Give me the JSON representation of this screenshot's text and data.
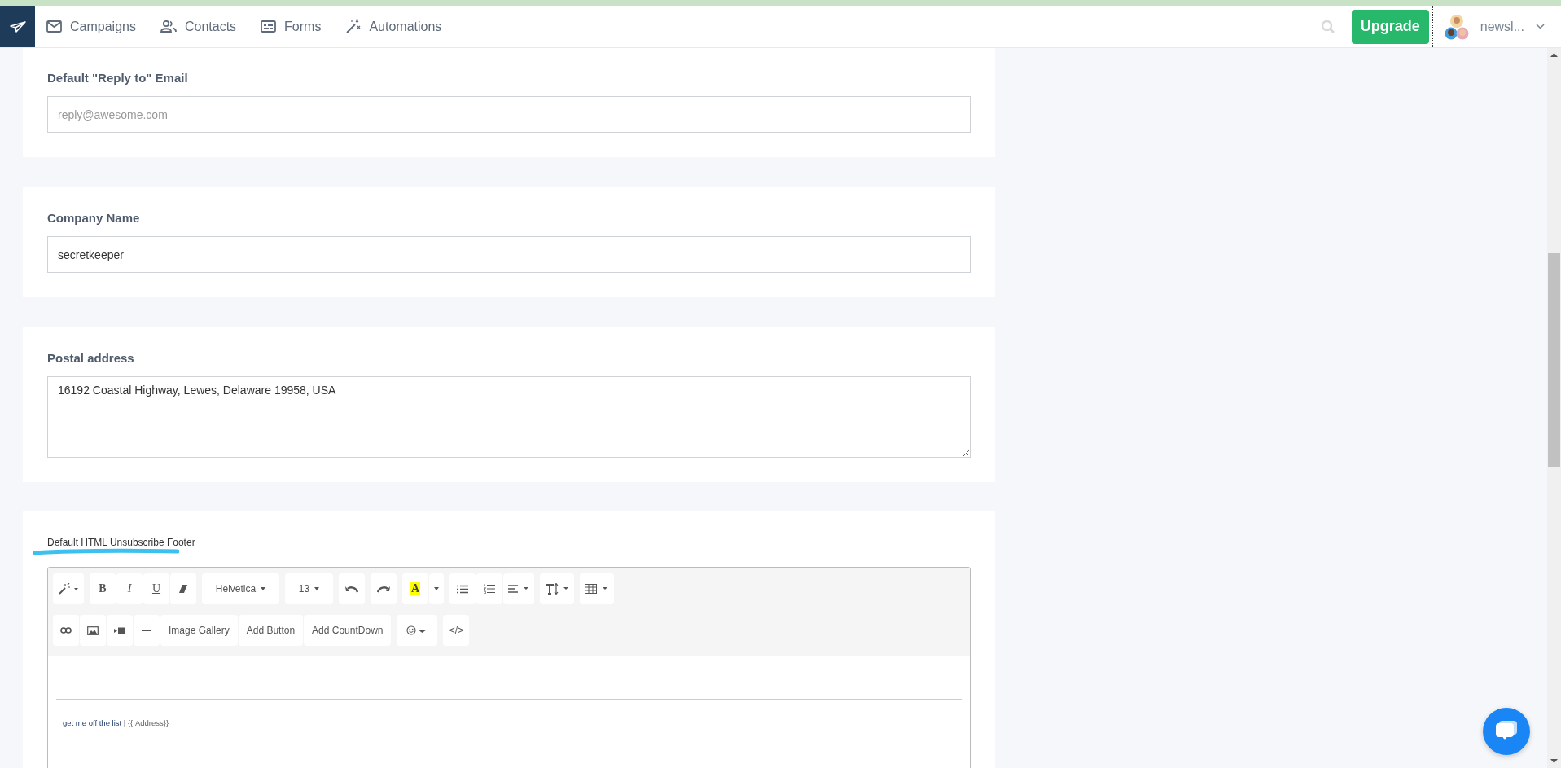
{
  "nav": {
    "items": [
      {
        "label": "Campaigns"
      },
      {
        "label": "Contacts"
      },
      {
        "label": "Forms"
      },
      {
        "label": "Automations"
      }
    ],
    "upgrade": "Upgrade",
    "account": "newsl..."
  },
  "sections": [
    {
      "label": "Default \"Reply to\" Email",
      "kind": "input",
      "placeholder": "reply@awesome.com"
    },
    {
      "label": "Company Name",
      "kind": "input",
      "value": "secretkeeper"
    },
    {
      "label": "Postal address",
      "kind": "textarea",
      "value": "16192 Coastal Highway, Lewes, Delaware 19958, USA"
    }
  ],
  "footer_section": {
    "label": "Default HTML Unsubscribe Footer",
    "editor": {
      "bold": "B",
      "italic": "I",
      "underline": "U",
      "font": "Helvetica",
      "size": "13",
      "highlight": "A",
      "inserts": [
        "Image Gallery",
        "Add Button",
        "Add CountDown"
      ],
      "code": "</>",
      "link": "get me off the list",
      "rest": " | {{.Address}}"
    }
  }
}
